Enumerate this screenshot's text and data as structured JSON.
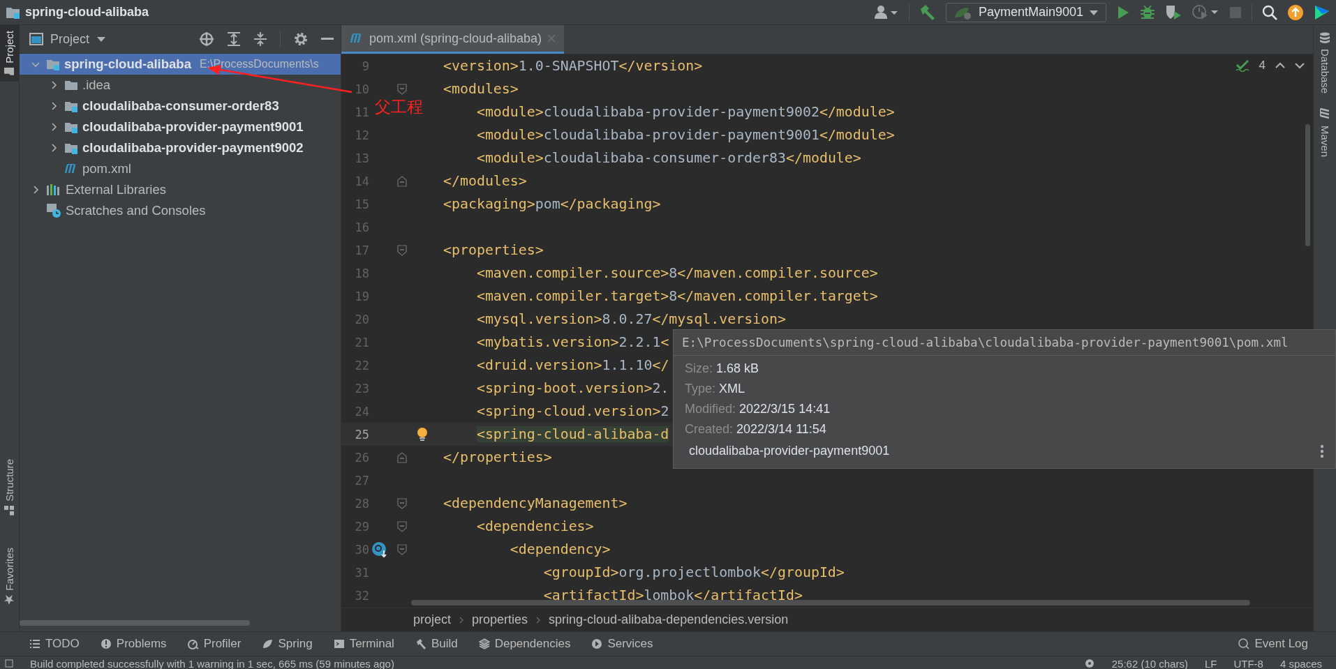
{
  "window": {
    "title": "spring-cloud-alibaba"
  },
  "toolbar": {
    "run_configuration": "PaymentMain9001"
  },
  "left_tool_strip": [
    {
      "label": "Project",
      "selected": true
    },
    {
      "label": "Structure",
      "selected": false
    },
    {
      "label": "Favorites",
      "selected": false
    }
  ],
  "project_panel": {
    "title": "Project",
    "tree": [
      {
        "label": "spring-cloud-alibaba",
        "path": "E:\\ProcessDocuments\\s",
        "kind": "project",
        "expanded": true,
        "selected": true,
        "children": [
          {
            "label": ".idea",
            "kind": "folder",
            "expanded": false,
            "selected": false
          },
          {
            "label": "cloudalibaba-consumer-order83",
            "kind": "module",
            "expanded": false,
            "selected": false
          },
          {
            "label": "cloudalibaba-provider-payment9001",
            "kind": "module",
            "expanded": false,
            "selected": false
          },
          {
            "label": "cloudalibaba-provider-payment9002",
            "kind": "module",
            "expanded": false,
            "selected": false
          },
          {
            "label": "pom.xml",
            "kind": "maven",
            "selected": false
          }
        ]
      },
      {
        "label": "External Libraries",
        "kind": "libraries",
        "expanded": false,
        "selected": false
      },
      {
        "label": "Scratches and Consoles",
        "kind": "scratches",
        "selected": false
      }
    ]
  },
  "annotation": {
    "text": "父工程"
  },
  "editor": {
    "tabs": [
      {
        "label": "pom.xml (spring-cloud-alibaba)",
        "selected": true
      }
    ],
    "inspection_count": "4",
    "lines": [
      {
        "number": "9",
        "code": "<version>1.0-SNAPSHOT</version>",
        "kind": "plain",
        "current": false
      },
      {
        "number": "10",
        "code": "<modules>",
        "kind": "fold_start",
        "current": false
      },
      {
        "number": "11",
        "code": "    <module>cloudalibaba-provider-payment9002</module>",
        "kind": "plain",
        "current": false
      },
      {
        "number": "12",
        "code": "    <module>cloudalibaba-provider-payment9001</module>",
        "kind": "plain",
        "current": false
      },
      {
        "number": "13",
        "code": "    <module>cloudalibaba-consumer-order83</module>",
        "kind": "plain",
        "current": false
      },
      {
        "number": "14",
        "code": "</modules>",
        "kind": "fold_end",
        "current": false
      },
      {
        "number": "15",
        "code": "<packaging>pom</packaging>",
        "kind": "plain",
        "current": false
      },
      {
        "number": "16",
        "kind": "plain",
        "current": false
      },
      {
        "number": "17",
        "code": "<properties>",
        "kind": "fold_start",
        "current": false
      },
      {
        "number": "18",
        "code": "    <maven.compiler.source>8</maven.compiler.source>",
        "kind": "plain",
        "current": false
      },
      {
        "number": "19",
        "code": "    <maven.compiler.target>8</maven.compiler.target>",
        "kind": "plain",
        "current": false
      },
      {
        "number": "20",
        "code": "    <mysql.version>8.0.27</mysql.version>",
        "kind": "plain",
        "current": false
      },
      {
        "number": "21",
        "code": "    <mybatis.version>2.2.1<",
        "kind": "plain",
        "current": false
      },
      {
        "number": "22",
        "code": "    <druid.version>1.1.10</",
        "kind": "plain",
        "current": false
      },
      {
        "number": "23",
        "code": "    <spring-boot.version>2.",
        "kind": "plain",
        "current": false
      },
      {
        "number": "24",
        "code": "    <spring-cloud.version>2",
        "kind": "plain",
        "current": false
      },
      {
        "number": "25",
        "code": "    <spring-cloud-alibaba-d",
        "kind": "intention",
        "current": true
      },
      {
        "number": "26",
        "code": "</properties>",
        "kind": "fold_end",
        "current": false
      },
      {
        "number": "27",
        "kind": "plain",
        "current": false
      },
      {
        "number": "28",
        "code": "<dependencyManagement>",
        "kind": "fold_start",
        "current": false
      },
      {
        "number": "29",
        "code": "    <dependencies>",
        "kind": "fold_start",
        "current": false
      },
      {
        "number": "30",
        "code": "        <dependency>",
        "kind": "fold_start_override",
        "current": false
      },
      {
        "number": "31",
        "code": "            <groupId>org.projectlombok</groupId>",
        "kind": "plain",
        "current": false
      },
      {
        "number": "32",
        "code": "            <artifactId>lombok</artifactId>",
        "kind": "plain",
        "current": false
      }
    ],
    "breadcrumbs": [
      "project",
      "properties",
      "spring-cloud-alibaba-dependencies.version"
    ]
  },
  "tooltip": {
    "path": "E:\\ProcessDocuments\\spring-cloud-alibaba\\cloudalibaba-provider-payment9001\\pom.xml",
    "fields": [
      {
        "label": "Size:",
        "value": "1.68 kB"
      },
      {
        "label": "Type:",
        "value": "XML"
      },
      {
        "label": "Modified:",
        "value": "2022/3/15 14:41"
      },
      {
        "label": "Created:",
        "value": "2022/3/14 11:54"
      }
    ],
    "module": "cloudalibaba-provider-payment9001"
  },
  "right_tool_strip": [
    {
      "label": "Database",
      "kind": "database"
    },
    {
      "label": "Maven",
      "kind": "maven"
    }
  ],
  "tool_windows": [
    {
      "label": "TODO",
      "kind": "list"
    },
    {
      "label": "Problems",
      "kind": "problems"
    },
    {
      "label": "Profiler",
      "kind": "profiler"
    },
    {
      "label": "Spring",
      "kind": "spring"
    },
    {
      "label": "Terminal",
      "kind": "terminal"
    },
    {
      "label": "Build",
      "kind": "build"
    },
    {
      "label": "Dependencies",
      "kind": "dependencies"
    },
    {
      "label": "Services",
      "kind": "services"
    }
  ],
  "event_log": "Event Log",
  "status_bar": {
    "message": "Build completed successfully with 1 warning in 1 sec, 665 ms (59 minutes ago)",
    "position": "25:62 (10 chars)",
    "line_separator": "LF",
    "encoding": "UTF-8",
    "indent": "4 spaces"
  }
}
